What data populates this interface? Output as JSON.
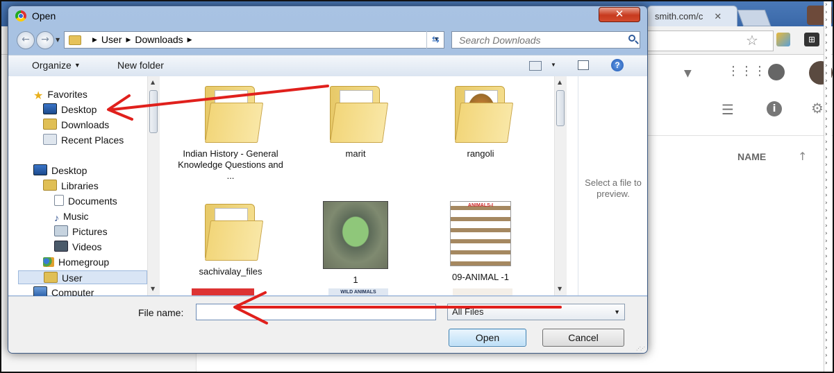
{
  "browser": {
    "tab_url_fragment": "smith.com/c",
    "tab_close": "✕",
    "drive_header_name": "NAME",
    "sort_arrow": "↑"
  },
  "dialog": {
    "title": "Open",
    "close_label": "✕",
    "breadcrumb": [
      "User",
      "Downloads"
    ],
    "search_placeholder": "Search Downloads",
    "organize_label": "Organize",
    "new_folder_label": "New folder",
    "nav": {
      "favorites": "Favorites",
      "desktop_fav": "Desktop",
      "downloads": "Downloads",
      "recent_places": "Recent Places",
      "desktop": "Desktop",
      "libraries": "Libraries",
      "documents": "Documents",
      "music": "Music",
      "pictures": "Pictures",
      "videos": "Videos",
      "homegroup": "Homegroup",
      "user": "User",
      "computer": "Computer"
    },
    "files": [
      {
        "name": "Indian History - General Knowledge Questions and ...",
        "kind": "folder"
      },
      {
        "name": "marit",
        "kind": "folder"
      },
      {
        "name": "rangoli",
        "kind": "folder"
      },
      {
        "name": "sachivalay_files",
        "kind": "folder"
      },
      {
        "name": "1",
        "kind": "image"
      },
      {
        "name": "09-ANIMAL -1",
        "kind": "image"
      }
    ],
    "partial_label": "WILD ANIMALS",
    "animals_title": "ANIMALS-I",
    "preview_text": "Select a file to preview.",
    "file_name_label": "File name:",
    "file_name_value": "",
    "file_type": "All Files",
    "open_label": "Open",
    "cancel_label": "Cancel"
  },
  "colors": {
    "annotation_arrow": "#e0201c",
    "dialog_frame": "#a9c3e3"
  }
}
